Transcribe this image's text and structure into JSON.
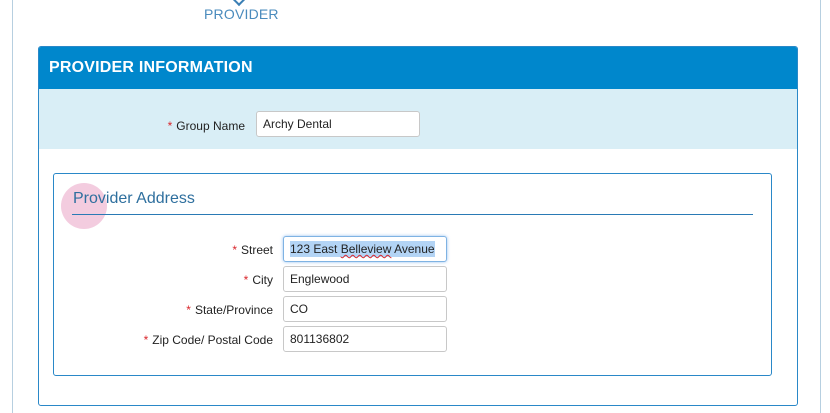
{
  "step": {
    "label": "PROVIDER"
  },
  "panel": {
    "title": "PROVIDER INFORMATION"
  },
  "group_name": {
    "required_mark": "*",
    "label": "Group Name",
    "value": "Archy Dental"
  },
  "address": {
    "title": "Provider Address",
    "fields": [
      {
        "required_mark": "*",
        "label": "Street",
        "value_pre": "123 East ",
        "value_misspelled": "Belleview",
        "value_post": " Avenue"
      },
      {
        "required_mark": "*",
        "label": "City",
        "value": "Englewood"
      },
      {
        "required_mark": "*",
        "label": "State/Province",
        "value": "CO"
      },
      {
        "required_mark": "*",
        "label": "Zip Code/ Postal Code",
        "value": "801136802"
      }
    ]
  },
  "colors": {
    "header_bg": "#0087cc",
    "group_row_bg": "#d9eef6",
    "required": "#d9252b",
    "accent_text": "#2e6f9e"
  }
}
